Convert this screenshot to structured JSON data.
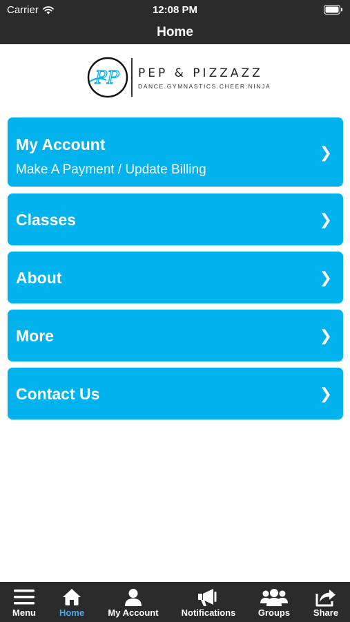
{
  "status_bar": {
    "carrier": "Carrier",
    "time": "12:08 PM"
  },
  "nav": {
    "title": "Home"
  },
  "logo": {
    "monogram": "PP",
    "brand": "PEP & PIZZAZZ",
    "tagline": "DANCE.GYMNASTICS.CHEER.NINJA"
  },
  "menu": [
    {
      "title": "My Account",
      "subtitle": "Make A Payment / Update Billing",
      "chevron": "❯"
    },
    {
      "title": "Classes",
      "chevron": "❯"
    },
    {
      "title": "About",
      "chevron": "❯"
    },
    {
      "title": "More",
      "chevron": "❯"
    },
    {
      "title": "Contact Us",
      "chevron": "❯"
    }
  ],
  "tabs": [
    {
      "label": "Menu",
      "icon": "hamburger-icon"
    },
    {
      "label": "Home",
      "icon": "home-icon",
      "active": true
    },
    {
      "label": "My Account",
      "icon": "user-icon"
    },
    {
      "label": "Notifications",
      "icon": "megaphone-icon"
    },
    {
      "label": "Groups",
      "icon": "group-icon"
    },
    {
      "label": "Share",
      "icon": "share-icon"
    }
  ],
  "colors": {
    "accent": "#01b2ec",
    "bar": "#2b2b2b",
    "active_tab": "#4aa8e8"
  }
}
